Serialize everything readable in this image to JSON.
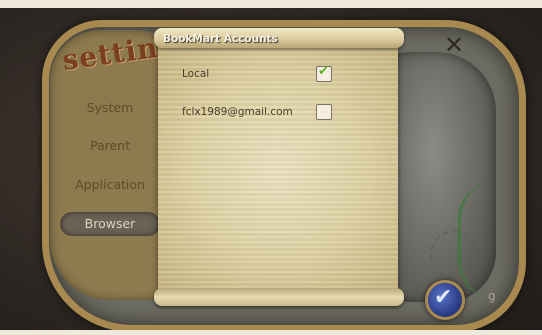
{
  "sidebar": {
    "title": "setting",
    "items": [
      {
        "label": "System"
      },
      {
        "label": "Parent"
      },
      {
        "label": "Application"
      },
      {
        "label": "Browser",
        "active": true
      }
    ]
  },
  "dialog": {
    "title": "BookMart Accounts",
    "accounts": [
      {
        "label": "Local",
        "checked": true
      },
      {
        "label": "fclx1989@gmail.com",
        "checked": false
      }
    ]
  },
  "controls": {
    "close_label": "✕",
    "confirm_label": "✔",
    "check_glyph": "✔"
  },
  "icons": {
    "close": "close-icon",
    "confirm": "check-icon"
  },
  "colors": {
    "accent_frame": "#a8894f",
    "parchment": "#ddd0a2",
    "active_tab": "#6b6154",
    "confirm_button": "#2c3f8a",
    "check_green": "#5fae2f"
  }
}
